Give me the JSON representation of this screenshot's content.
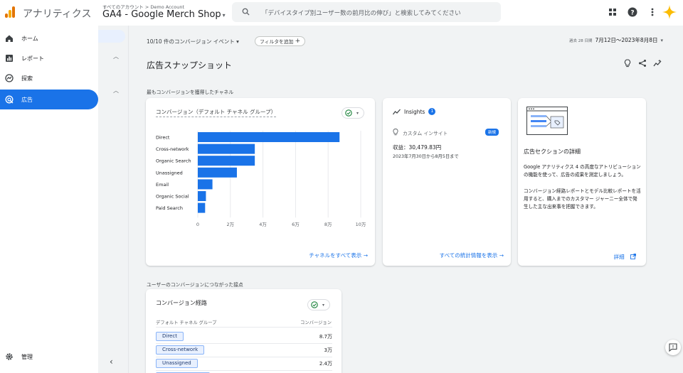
{
  "app": {
    "name": "アナリティクス",
    "breadcrumb": "すべてのアカウント > Demo Account",
    "property": "GA4 - Google Merch Shop",
    "colors": {
      "accent": "#1a73e8",
      "logo_dark": "#e37400",
      "logo_light": "#f9ab00"
    }
  },
  "search": {
    "placeholder": "「デバイスタイプ別ユーザー数の前月比の伸び」と検索してみてください"
  },
  "topbar_icons": [
    "apps-grid-icon",
    "help-icon",
    "more-vert-icon",
    "sparkle-icon"
  ],
  "sidebar": {
    "items": [
      {
        "label": "ホーム",
        "icon": "home-icon"
      },
      {
        "label": "レポート",
        "icon": "bar-chart-icon"
      },
      {
        "label": "探索",
        "icon": "explore-icon"
      },
      {
        "label": "広告",
        "icon": "ads-icon",
        "active": true
      }
    ],
    "admin_label": "管理"
  },
  "filters": {
    "conversion_events": "10/10 件のコンバージョン イベント",
    "add_filter": "フィルタを追加",
    "date_prefix": "過去 28 日間",
    "date_range": "7月12日〜2023年8月8日"
  },
  "page_title": "広告スナップショット",
  "section1_label": "最もコンバージョンを獲得したチャネル",
  "section2_label": "ユーザーのコンバージョンにつながった接点",
  "chart_card": {
    "title": "コンバージョン（デフォルト チャネル グループ）",
    "link": "チャネルをすべて表示"
  },
  "chart_data": {
    "type": "bar",
    "orientation": "horizontal",
    "categories": [
      "Direct",
      "Cross-network",
      "Organic Search",
      "Unassigned",
      "Email",
      "Organic Social",
      "Paid Search"
    ],
    "values": [
      87000,
      35000,
      35000,
      24000,
      9000,
      5000,
      4500
    ],
    "xticks": [
      "0",
      "2万",
      "4万",
      "6万",
      "8万",
      "10万"
    ],
    "xlim": [
      0,
      100000
    ],
    "grid": true,
    "color": "#1a73e8"
  },
  "insights_card": {
    "title": "Insights",
    "count": "1",
    "item_title": "カスタム インサイト",
    "new_label": "新規",
    "revenue_label": "収益：30,479.83円",
    "revenue_range": "2023年7月30日から8月5日まで",
    "link": "すべての統計情報を表示"
  },
  "info_card": {
    "title": "広告セクションの詳細",
    "body1": "Google アナリティクス 4 の高度なアトリビューションの機能を使って、広告の成果を測定しましょう。",
    "body2": "コンバージョン経路レポートとモデル比較レポートを活用すると、購入までのカスタマー ジャーニー全体で発生した主な出来事を把握できます。",
    "link": "詳細"
  },
  "path_card": {
    "title": "コンバージョン経路",
    "col1": "デフォルト チャネル グループ",
    "col2": "コンバージョン",
    "rows": [
      {
        "label": "Direct",
        "value": "8.7万"
      },
      {
        "label": "Cross-network",
        "value": "3万"
      },
      {
        "label": "Unassigned",
        "value": "2.4万"
      }
    ]
  }
}
